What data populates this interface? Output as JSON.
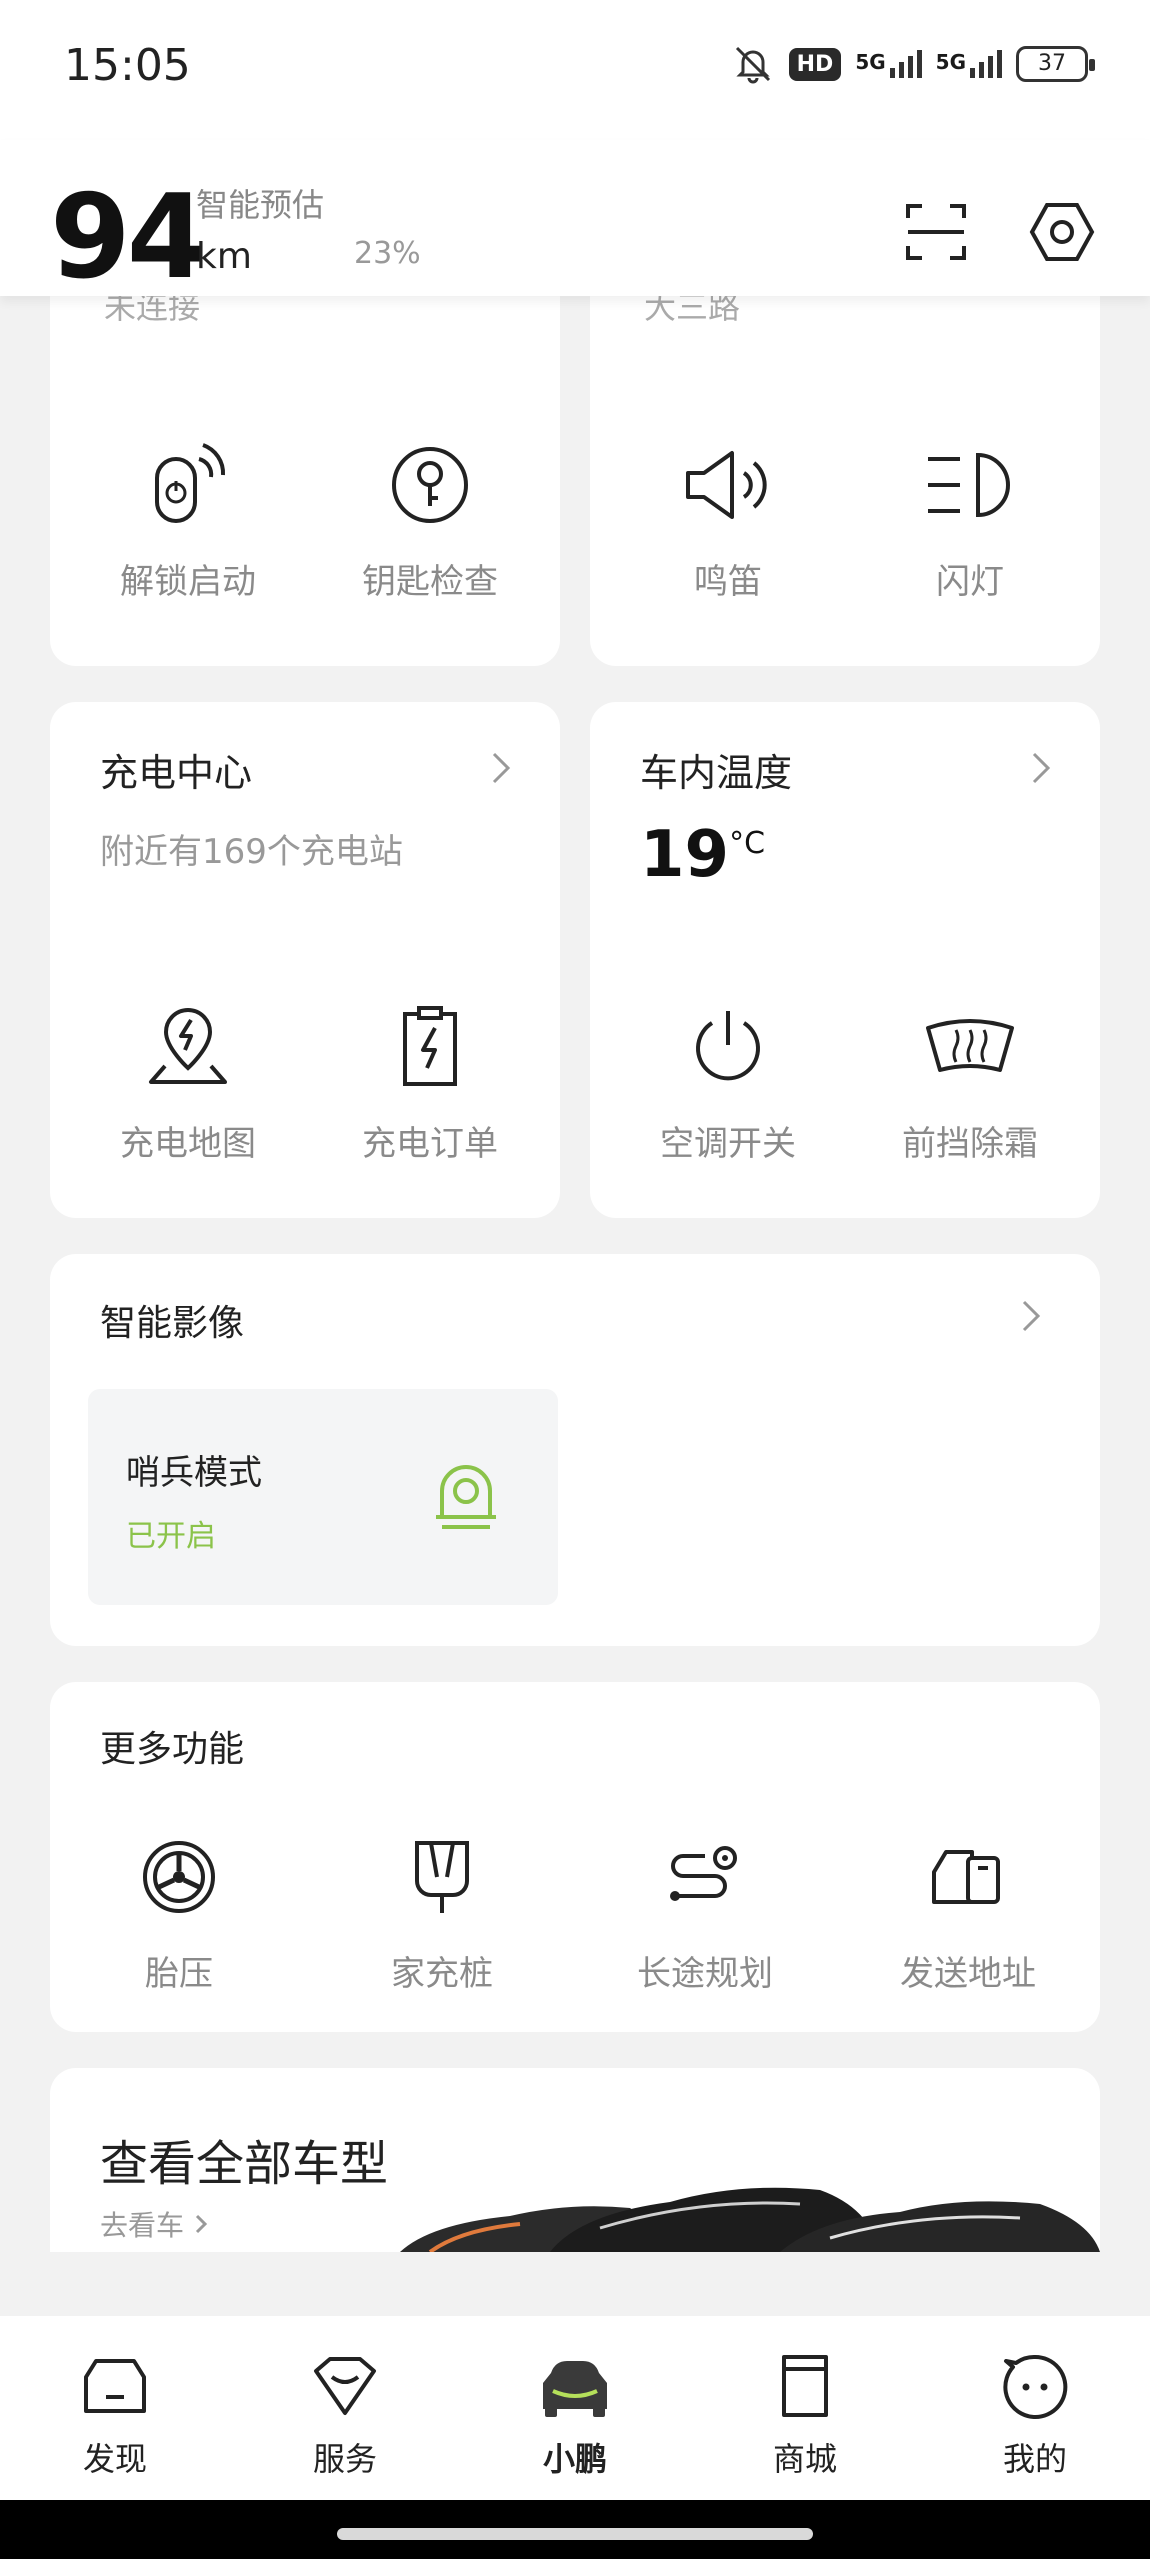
{
  "status_bar": {
    "time": "15:05",
    "hd_label": "HD",
    "net1": "5G",
    "net2": "5G",
    "battery": "37"
  },
  "header": {
    "range_value": "94",
    "range_label": "智能预估",
    "range_unit": "km",
    "range_percent": "23%"
  },
  "top_cards": {
    "left_status": "未连接",
    "right_location": "大三路",
    "left_features": [
      {
        "label": "解锁启动",
        "icon": "phone-key-icon"
      },
      {
        "label": "钥匙检查",
        "icon": "key-icon"
      }
    ],
    "right_features": [
      {
        "label": "鸣笛",
        "icon": "horn-icon"
      },
      {
        "label": "闪灯",
        "icon": "headlight-icon"
      }
    ]
  },
  "charge_card": {
    "title": "充电中心",
    "subtitle": "附近有169个充电站",
    "features": [
      {
        "label": "充电地图",
        "icon": "charge-map-icon"
      },
      {
        "label": "充电订单",
        "icon": "charge-order-icon"
      }
    ]
  },
  "temp_card": {
    "title": "车内温度",
    "value": "19",
    "unit": "°C",
    "features": [
      {
        "label": "空调开关",
        "icon": "power-icon"
      },
      {
        "label": "前挡除霜",
        "icon": "defrost-icon"
      }
    ]
  },
  "imaging_card": {
    "title": "智能影像",
    "sentry_title": "哨兵模式",
    "sentry_status": "已开启",
    "accent": "#8bc34a"
  },
  "more_card": {
    "title": "更多功能",
    "features": [
      {
        "label": "胎压",
        "icon": "tire-icon"
      },
      {
        "label": "家充桩",
        "icon": "home-charger-icon"
      },
      {
        "label": "长途规划",
        "icon": "route-icon"
      },
      {
        "label": "发送地址",
        "icon": "send-address-icon"
      }
    ]
  },
  "models_card": {
    "title": "查看全部车型",
    "link": "去看车"
  },
  "tabbar": {
    "tabs": [
      {
        "label": "发现",
        "icon": "discover-icon"
      },
      {
        "label": "服务",
        "icon": "service-icon"
      },
      {
        "label": "小鹏",
        "icon": "car-icon",
        "active": true
      },
      {
        "label": "商城",
        "icon": "shop-icon"
      },
      {
        "label": "我的",
        "icon": "profile-icon"
      }
    ]
  }
}
